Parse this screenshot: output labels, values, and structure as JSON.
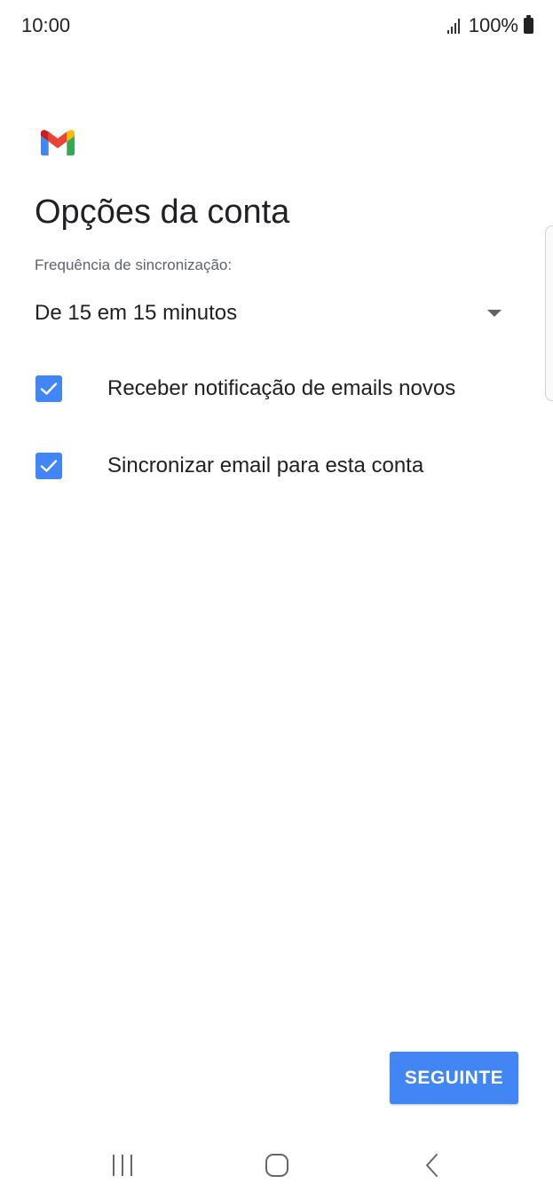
{
  "status_bar": {
    "time": "10:00",
    "battery_percent": "100%",
    "icons": [
      "signal-icon",
      "battery-icon"
    ]
  },
  "app": {
    "logo_icon": "gmail-logo-icon",
    "title": "Opções da conta"
  },
  "sync": {
    "label": "Frequência de sincronização:",
    "selected_value": "De 15 em 15 minutos"
  },
  "options": [
    {
      "label": "Receber notificação de emails novos",
      "checked": true
    },
    {
      "label": "Sincronizar email para esta conta",
      "checked": true
    }
  ],
  "buttons": {
    "next_label": "SEGUINTE"
  },
  "navigation": {
    "recents_icon": "recents-icon",
    "home_icon": "home-icon",
    "back_icon": "back-icon"
  },
  "colors": {
    "accent": "#4285f4",
    "gmail_red": "#ea4335",
    "gmail_blue": "#4285f4",
    "gmail_green": "#34a853",
    "gmail_yellow": "#fbbc04",
    "gmail_dark_red": "#c5221f"
  }
}
